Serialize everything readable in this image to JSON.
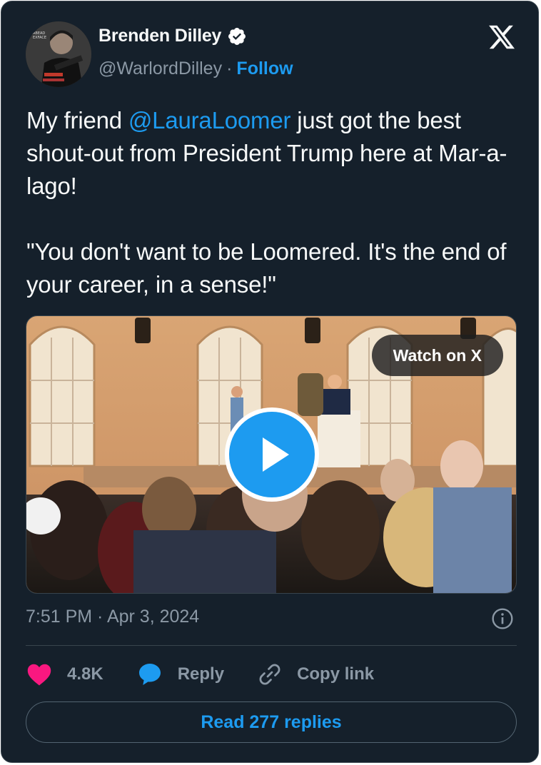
{
  "author": {
    "display_name": "Brenden Dilley",
    "handle": "@WarlordDilley",
    "separator": "·",
    "follow_label": "Follow",
    "verified": true
  },
  "tweet": {
    "line1_before": "My friend ",
    "mention": "@LauraLoomer",
    "line1_after": " just got the best shout-out from President Trump here at Mar-a-lago!",
    "quote": "\"You don't want to be Loomered. It's the end of your career, in a sense!\""
  },
  "media": {
    "watch_label": "Watch on X"
  },
  "meta": {
    "timestamp": "7:51 PM · Apr 3, 2024"
  },
  "actions": {
    "like_count": "4.8K",
    "reply_label": "Reply",
    "copy_link_label": "Copy link"
  },
  "read_replies_label": "Read 277 replies",
  "colors": {
    "background": "#15202b",
    "accent": "#1d9bf0",
    "like": "#f91880",
    "muted": "#8b98a5"
  },
  "icons": [
    "verified-badge-icon",
    "x-logo-icon",
    "play-icon",
    "info-icon",
    "heart-icon",
    "reply-bubble-icon",
    "link-icon"
  ]
}
